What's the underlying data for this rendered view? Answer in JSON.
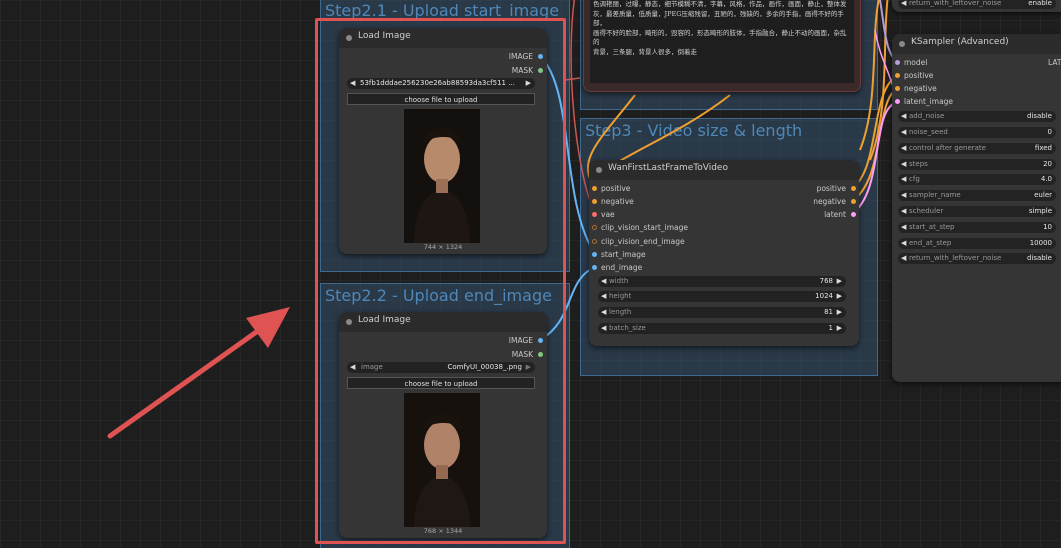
{
  "groups": {
    "step21": {
      "title": "Step2.1 - Upload start_image"
    },
    "step22": {
      "title": "Step2.2 - Upload end_image"
    },
    "step3": {
      "title": "Step3 - Video size & length"
    }
  },
  "load_image_1": {
    "title": "Load Image",
    "outputs": [
      "IMAGE",
      "MASK"
    ],
    "image_value": "53fb1dddae256230e26ab88593da3cf511 ...",
    "upload_label": "choose file to upload",
    "caption": "744 × 1324"
  },
  "load_image_2": {
    "title": "Load Image",
    "outputs": [
      "IMAGE",
      "MASK"
    ],
    "image_name": "image",
    "image_value": "ComfyUI_00038_.png",
    "upload_label": "choose file to upload",
    "caption": "768 × 1344"
  },
  "prompt_node": {
    "text_line1": "色调艳丽，过曝，静态，细节模糊不清，字幕，风格，作品，画作，画面，静止，整体发",
    "text_line2": "灰，最差质量，低质量，JPEG压缩残留，丑陋的，残缺的，多余的手指，画得不好的手部，",
    "text_line3": "画得不好的脸部，畸形的，毁容的，形态畸形的肢体，手指融合，静止不动的画面，杂乱的",
    "text_line4": "背景，三条腿，背景人很多，倒着走"
  },
  "wan_node": {
    "title": "WanFirstLastFrameToVideo",
    "inputs": [
      "positive",
      "negative",
      "vae",
      "clip_vision_start_image",
      "clip_vision_end_image",
      "start_image",
      "end_image"
    ],
    "outputs": [
      "positive",
      "negative",
      "latent"
    ],
    "widgets": [
      {
        "name": "width",
        "value": "768"
      },
      {
        "name": "height",
        "value": "1024"
      },
      {
        "name": "length",
        "value": "81"
      },
      {
        "name": "batch_size",
        "value": "1"
      }
    ]
  },
  "ksampler": {
    "top_row_name": "return_with_leftover_noise",
    "top_row_value": "enable",
    "title": "KSampler (Advanced)",
    "inputs": [
      "model",
      "positive",
      "negative",
      "latent_image"
    ],
    "output": "LATENT",
    "widgets": [
      {
        "name": "add_noise",
        "value": "disable"
      },
      {
        "name": "noise_seed",
        "value": "0"
      },
      {
        "name": "control after generate",
        "value": "fixed"
      },
      {
        "name": "steps",
        "value": "20"
      },
      {
        "name": "cfg",
        "value": "4.0"
      },
      {
        "name": "sampler_name",
        "value": "euler"
      },
      {
        "name": "scheduler",
        "value": "simple"
      },
      {
        "name": "start_at_step",
        "value": "10"
      },
      {
        "name": "end_at_step",
        "value": "10000"
      },
      {
        "name": "return_with_leftover_noise",
        "value": "disable"
      }
    ]
  },
  "colors": {
    "conditioning": "#f0a030",
    "image": "#64b5f6",
    "mask": "#81c784",
    "latent": "#ff9cf9",
    "vae": "#ff6e6e",
    "clip_vision": "#a6703a",
    "model": "#b39ddb",
    "highlight": "#e05353"
  }
}
